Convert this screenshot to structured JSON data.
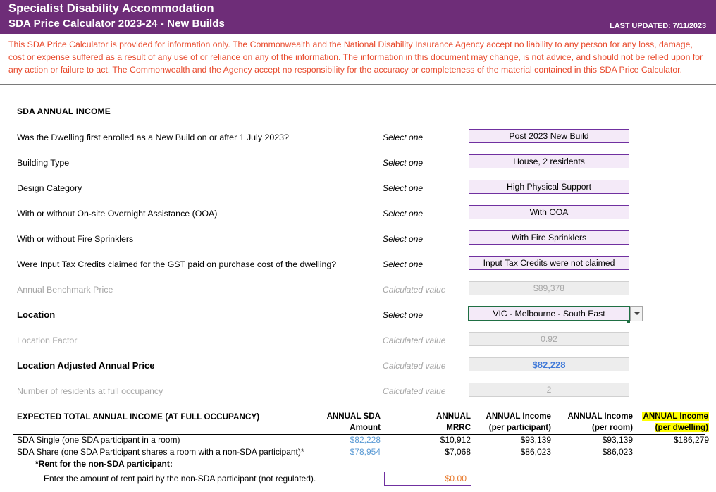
{
  "header": {
    "title_line1": "Specialist Disability Accommodation",
    "title_line2": "SDA Price Calculator 2023-24 - New Builds",
    "last_updated": "LAST UPDATED: 7/11/2023",
    "banner_color": "#6E2D78"
  },
  "disclaimer": {
    "text": "This SDA Price Calculator is provided for information only.  The Commonwealth and the National Disability Insurance Agency accept no liability to any person for any loss, damage, cost or expense suffered as a result of any use of or reliance on any of the information.  The information in this document may change, is not advice, and should not be relied upon for any action or failure to act. The Commonwealth and the Agency accept no responsibility for the accuracy or completeness of the material contained in this SDA Price Calculator.",
    "color": "#E8492B"
  },
  "section": {
    "title": "SDA ANNUAL INCOME"
  },
  "form": {
    "select_hint": "Select one",
    "calculated_hint": "Calculated value",
    "rows": [
      {
        "label": "Was the Dwelling first enrolled as a New Build on or after 1 July 2023?",
        "hint": "Select one",
        "value": "Post 2023 New Build",
        "kind": "select"
      },
      {
        "label": "Building Type",
        "hint": "Select one",
        "value": "House, 2 residents",
        "kind": "select"
      },
      {
        "label": "Design Category",
        "hint": "Select one",
        "value": "High Physical Support",
        "kind": "select"
      },
      {
        "label": "With or without On-site Overnight Assistance (OOA)",
        "hint": "Select one",
        "value": "With OOA",
        "kind": "select"
      },
      {
        "label": "With or without Fire Sprinklers",
        "hint": "Select one",
        "value": "With Fire Sprinklers",
        "kind": "select"
      },
      {
        "label": "Were Input Tax Credits claimed for the GST paid on purchase cost of the dwelling?",
        "hint": "Select one",
        "value": "Input Tax Credits were not claimed",
        "kind": "select"
      },
      {
        "label": "Annual Benchmark Price",
        "hint": "Calculated value",
        "value": "$89,378",
        "kind": "calc"
      },
      {
        "label": "Location",
        "hint": "Select one",
        "value": "VIC - Melbourne - South East",
        "kind": "select-active"
      },
      {
        "label": "Location Factor",
        "hint": "Calculated value",
        "value": "0.92",
        "kind": "calc"
      },
      {
        "label": "Location Adjusted Annual Price",
        "hint": "Calculated value",
        "value": "$82,228",
        "kind": "calc-blue"
      },
      {
        "label": "Number of residents at full occupancy",
        "hint": "Calculated value",
        "value": "2",
        "kind": "calc"
      }
    ]
  },
  "table": {
    "title": "EXPECTED TOTAL ANNUAL INCOME (AT FULL OCCUPANCY)",
    "columns": [
      {
        "line1": "ANNUAL SDA",
        "line2": "Amount"
      },
      {
        "line1": "ANNUAL",
        "line2": "MRRC"
      },
      {
        "line1": "ANNUAL Income",
        "line2": "(per participant)"
      },
      {
        "line1": "ANNUAL Income",
        "line2": "(per room)"
      },
      {
        "line1": "ANNUAL Income",
        "line2": "(per dwelling)"
      }
    ],
    "rows": [
      {
        "label": "SDA Single (one SDA participant in a room)",
        "sda_amount": "$82,228",
        "mrrc": "$10,912",
        "per_participant": "$93,139",
        "per_room": "$93,139",
        "per_dwelling": "$186,279"
      },
      {
        "label": "SDA Share (one SDA Participant shares a room with a non-SDA participant)*",
        "sda_amount": "$78,954",
        "mrrc": "$7,068",
        "per_participant": "$86,023",
        "per_room": "$86,023",
        "per_dwelling": ""
      }
    ],
    "footnote_heading": "*Rent for the non-SDA participant:",
    "footnote_label": "Enter the amount of rent paid by the non-SDA participant (not regulated).",
    "rent_value": "$0.00",
    "highlight_color": "#FFFF00"
  }
}
